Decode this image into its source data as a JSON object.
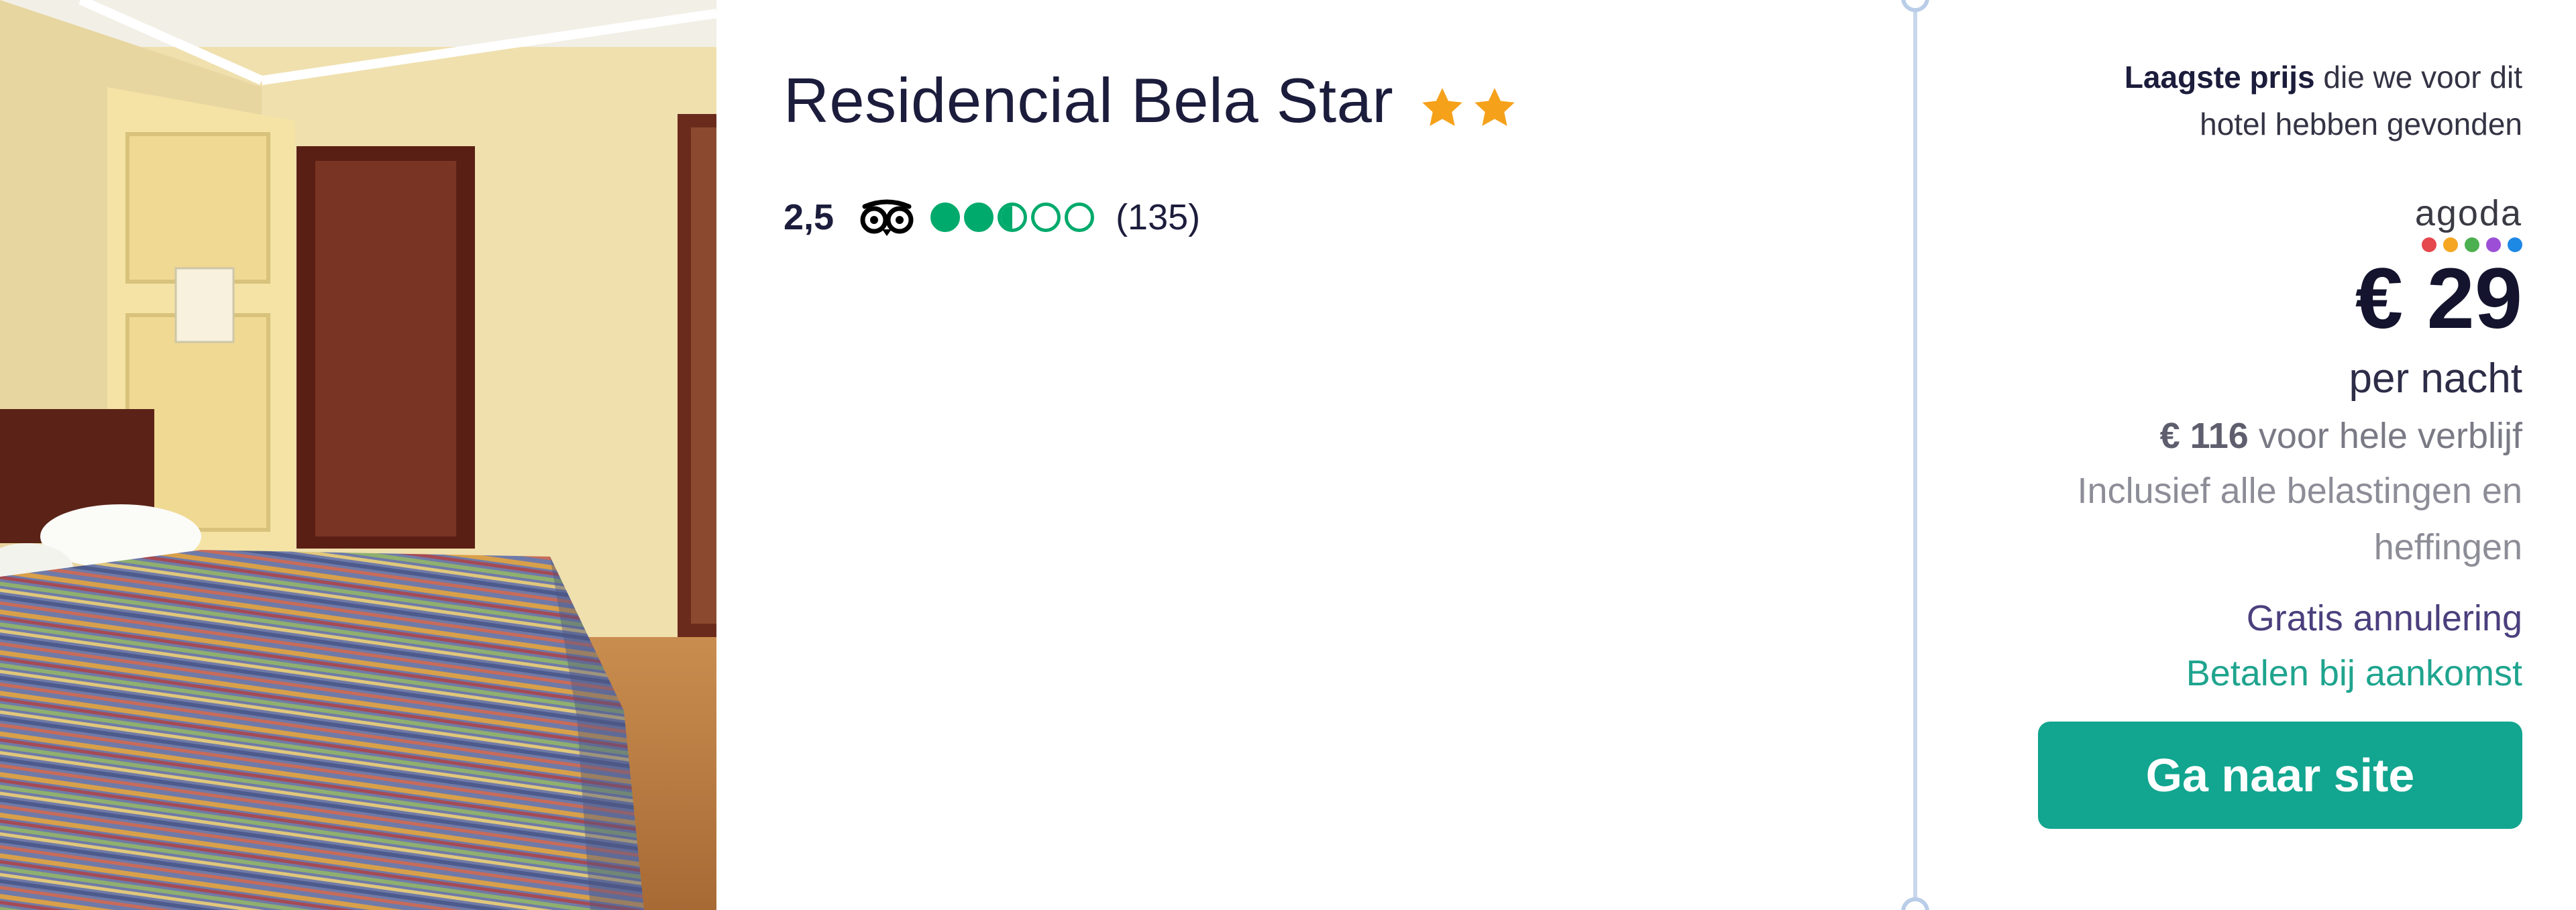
{
  "hotel": {
    "name": "Residencial Bela Star",
    "star_count": 2,
    "rating_value": "2,5",
    "bubbles": [
      1,
      1,
      0.5,
      0,
      0
    ],
    "review_count": "(135)",
    "icons": {
      "stars": "star-icon",
      "review_site": "tripadvisor-owl-icon"
    }
  },
  "offer": {
    "lowest_label": "Laagste prijs",
    "lowest_rest_line1": "die we voor dit",
    "lowest_line2": "hotel hebben gevonden",
    "provider": "agoda",
    "provider_dot_colors": [
      "#e5484d",
      "#f5a623",
      "#4caf50",
      "#9c4fd6",
      "#1e88e5"
    ],
    "price": "€ 29",
    "per_night": "per nacht",
    "total_amount": "€ 116",
    "total_suffix": "voor hele verblijf",
    "taxes_line1": "Inclusief alle belastingen en",
    "taxes_line2": "heffingen",
    "free_cancellation": "Gratis annulering",
    "pay_later": "Betalen bij aankomst",
    "cta_label": "Ga naar site"
  },
  "colors": {
    "star": "#f5a11a",
    "bubble": "#00aa6c",
    "cta": "#12a58f",
    "cancel_text": "#4b3f7d",
    "pay_text": "#1fa48e"
  }
}
